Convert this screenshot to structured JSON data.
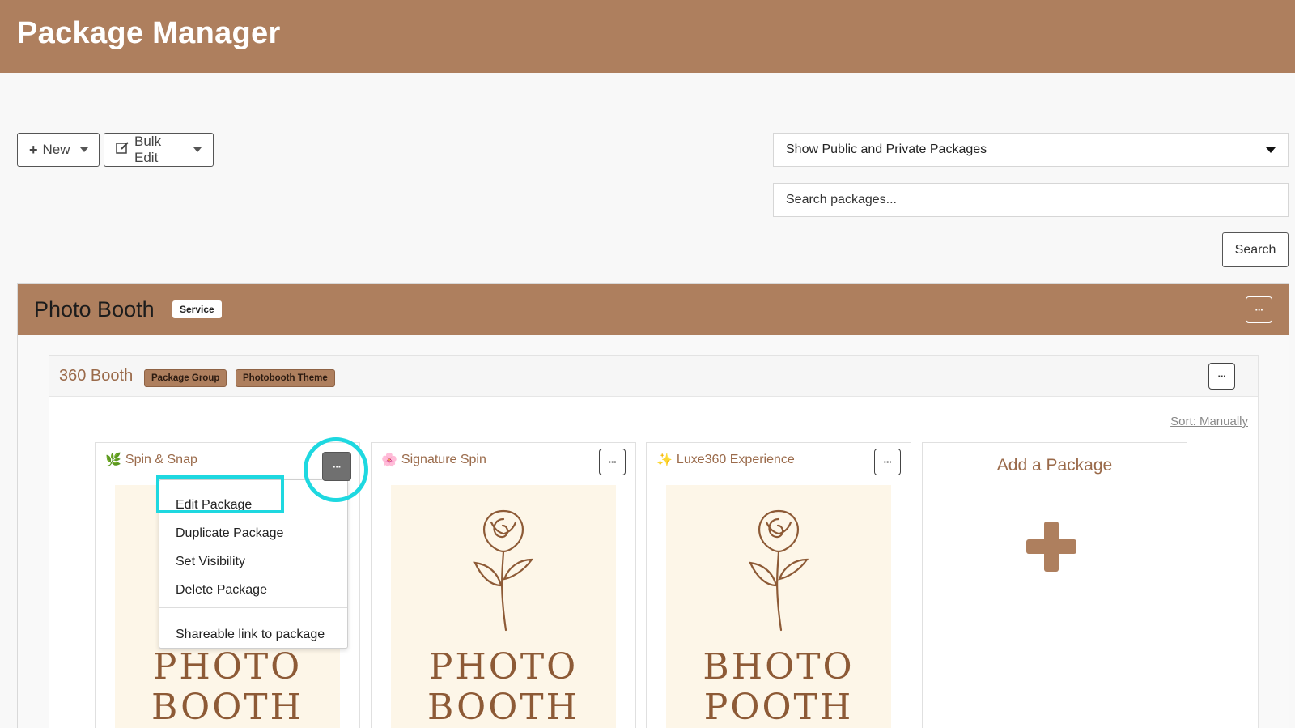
{
  "header": {
    "title": "Package Manager"
  },
  "toolbar": {
    "new_label": "New",
    "bulk_edit_label": "Bulk Edit",
    "filter_selected": "Show Public and Private Packages",
    "search_placeholder": "Search packages...",
    "search_button": "Search"
  },
  "section": {
    "title": "Photo Booth",
    "badge": "Service",
    "more": "···"
  },
  "group": {
    "title": "360 Booth",
    "badges": [
      "Package Group",
      "Photobooth Theme"
    ],
    "more": "···",
    "sort_label": "Sort: Manually"
  },
  "cards": [
    {
      "emoji": "🌿",
      "title": "Spin & Snap",
      "poster_line1": "PHOTO",
      "poster_line2": "BOOTH",
      "more": "···"
    },
    {
      "emoji": "🌸",
      "title": "Signature Spin",
      "poster_line1": "PHOTO",
      "poster_line2": "BOOTH",
      "more": "···"
    },
    {
      "emoji": "✨",
      "title": "Luxe360 Experience",
      "poster_line1": "BHOTO",
      "poster_line2": "POOTH",
      "more": "···"
    }
  ],
  "add_card": {
    "title": "Add a Package"
  },
  "context_menu": {
    "items": [
      "Edit Package",
      "Duplicate Package",
      "Set Visibility",
      "Delete Package"
    ],
    "footer_item": "Shareable link to package"
  },
  "colors": {
    "brand": "#ae7f5e",
    "highlight": "#1ed8e0",
    "text_accent": "#9a6a4a"
  }
}
